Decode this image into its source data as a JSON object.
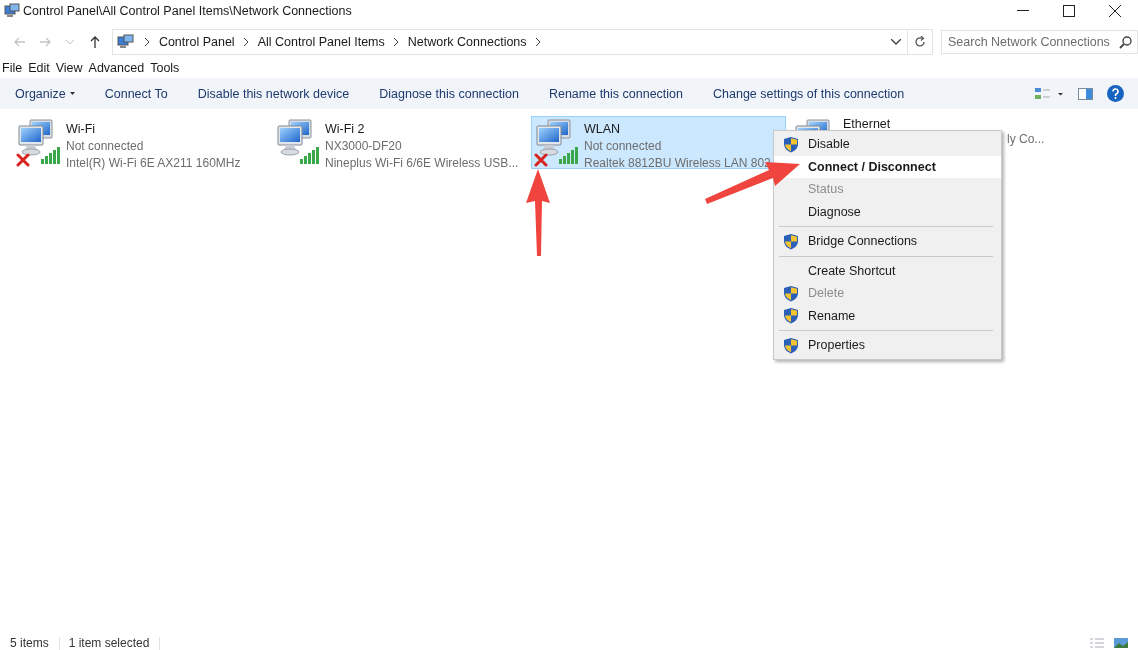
{
  "window": {
    "title": "Control Panel\\All Control Panel Items\\Network Connections"
  },
  "address_bar": {
    "breadcrumbs": [
      "Control Panel",
      "All Control Panel Items",
      "Network Connections"
    ]
  },
  "search": {
    "placeholder": "Search Network Connections"
  },
  "menu_bar": [
    "File",
    "Edit",
    "View",
    "Advanced",
    "Tools"
  ],
  "command_bar": [
    {
      "label": "Organize",
      "kind": "dropdown"
    },
    {
      "label": "Connect To",
      "kind": "button"
    },
    {
      "label": "Disable this network device",
      "kind": "button"
    },
    {
      "label": "Diagnose this connection",
      "kind": "button"
    },
    {
      "label": "Rename this connection",
      "kind": "button"
    },
    {
      "label": "Change settings of this connection",
      "kind": "button"
    }
  ],
  "connections": [
    {
      "name": "Wi-Fi",
      "status": "Not connected",
      "device": "Intel(R) Wi-Fi 6E AX211 160MHz",
      "kind": "wireless",
      "disconnected": true,
      "selected": false,
      "covered": false
    },
    {
      "name": "Wi-Fi 2",
      "status": "NX3000-DF20",
      "device": "Nineplus Wi-Fi 6/6E Wireless USB...",
      "kind": "wireless",
      "disconnected": false,
      "selected": false,
      "covered": false
    },
    {
      "name": "WLAN",
      "status": "Not connected",
      "device": "Realtek 8812BU Wireless LAN 802",
      "kind": "wireless",
      "disconnected": true,
      "selected": true,
      "covered": false
    },
    {
      "name": "Ethernet",
      "device": "ly Co...",
      "kind": "wired",
      "disconnected": false,
      "selected": false,
      "covered": true
    }
  ],
  "context_menu": {
    "items": [
      {
        "kind": "item",
        "label": "Disable",
        "shield": true,
        "disabled": false,
        "default": false,
        "selected": false
      },
      {
        "kind": "item",
        "label": "Connect / Disconnect",
        "shield": false,
        "disabled": false,
        "default": true,
        "selected": true
      },
      {
        "kind": "item",
        "label": "Status",
        "shield": false,
        "disabled": true,
        "default": false,
        "selected": false
      },
      {
        "kind": "item",
        "label": "Diagnose",
        "shield": false,
        "disabled": false,
        "default": false,
        "selected": false
      },
      {
        "kind": "separator"
      },
      {
        "kind": "item",
        "label": "Bridge Connections",
        "shield": true,
        "disabled": false,
        "default": false,
        "selected": false
      },
      {
        "kind": "separator"
      },
      {
        "kind": "item",
        "label": "Create Shortcut",
        "shield": false,
        "disabled": false,
        "default": false,
        "selected": false
      },
      {
        "kind": "item",
        "label": "Delete",
        "shield": true,
        "disabled": true,
        "default": false,
        "selected": false
      },
      {
        "kind": "item",
        "label": "Rename",
        "shield": true,
        "disabled": false,
        "default": false,
        "selected": false
      },
      {
        "kind": "separator"
      },
      {
        "kind": "item",
        "label": "Properties",
        "shield": true,
        "disabled": false,
        "default": false,
        "selected": false
      }
    ]
  },
  "status_bar": {
    "item_count": "5 items",
    "selection": "1 item selected"
  }
}
